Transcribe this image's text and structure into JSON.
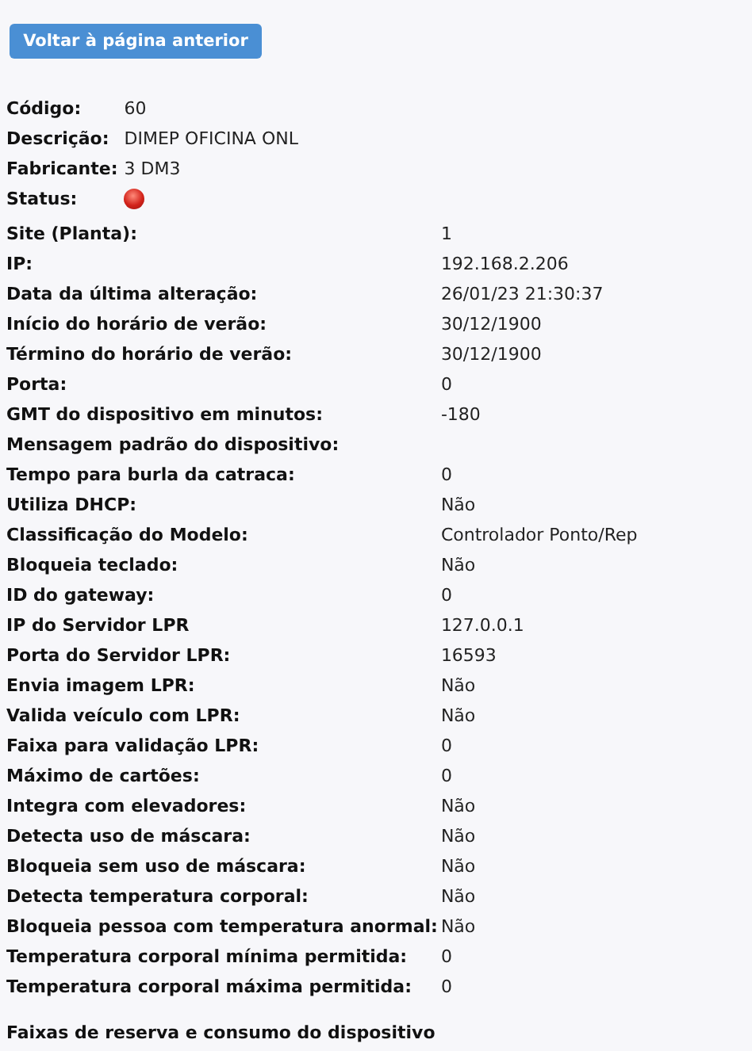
{
  "back_button": "Voltar à página anterior",
  "summary": [
    {
      "label": "Código:",
      "value": "60"
    },
    {
      "label": "Descrição:",
      "value": "DIMEP OFICINA ONL"
    },
    {
      "label": "Fabricante:",
      "value": "3 DM3"
    },
    {
      "label": "Status:",
      "kind": "status",
      "online": false
    }
  ],
  "details": [
    {
      "label": "Site (Planta):",
      "value": "1"
    },
    {
      "label": "IP:",
      "value": "192.168.2.206"
    },
    {
      "label": "Data da última alteração:",
      "value": "26/01/23 21:30:37"
    },
    {
      "label": "Início do horário de verão:",
      "value": "30/12/1900"
    },
    {
      "label": "Término do horário de verão:",
      "value": "30/12/1900"
    },
    {
      "label": "Porta:",
      "value": "0"
    },
    {
      "label": "GMT do dispositivo em minutos:",
      "value": "-180"
    },
    {
      "label": "Mensagem padrão do dispositivo:"
    },
    {
      "label": "Tempo para burla da catraca:",
      "value": "0"
    },
    {
      "label": "Utiliza DHCP:",
      "value": "Não"
    },
    {
      "label": "Classificação do Modelo:",
      "value": "Controlador Ponto/Rep"
    },
    {
      "label": "Bloqueia teclado:",
      "value": "Não"
    },
    {
      "label": "ID do gateway:",
      "value": "0"
    },
    {
      "label": "IP do Servidor LPR",
      "value": "127.0.0.1"
    },
    {
      "label": "Porta do Servidor LPR:",
      "value": "16593"
    },
    {
      "label": "Envia imagem LPR:",
      "value": "Não"
    },
    {
      "label": "Valida veículo com LPR:",
      "value": "Não"
    },
    {
      "label": "Faixa para validação LPR:",
      "value": "0"
    },
    {
      "label": "Máximo de cartões:",
      "value": "0"
    },
    {
      "label": "Integra com elevadores:",
      "value": "Não"
    },
    {
      "label": "Detecta uso de máscara:",
      "value": "Não"
    },
    {
      "label": "Bloqueia sem uso de máscara:",
      "value": "Não"
    },
    {
      "label": "Detecta temperatura corporal:",
      "value": "Não"
    },
    {
      "label": "Bloqueia pessoa com temperatura anormal:",
      "value": "Não"
    },
    {
      "label": "Temperatura corporal mínima permitida:",
      "value": "0"
    },
    {
      "label": "Temperatura corporal máxima permitida:",
      "value": "0"
    }
  ],
  "section_title": "Faixas de reserva e consumo do dispositivo"
}
